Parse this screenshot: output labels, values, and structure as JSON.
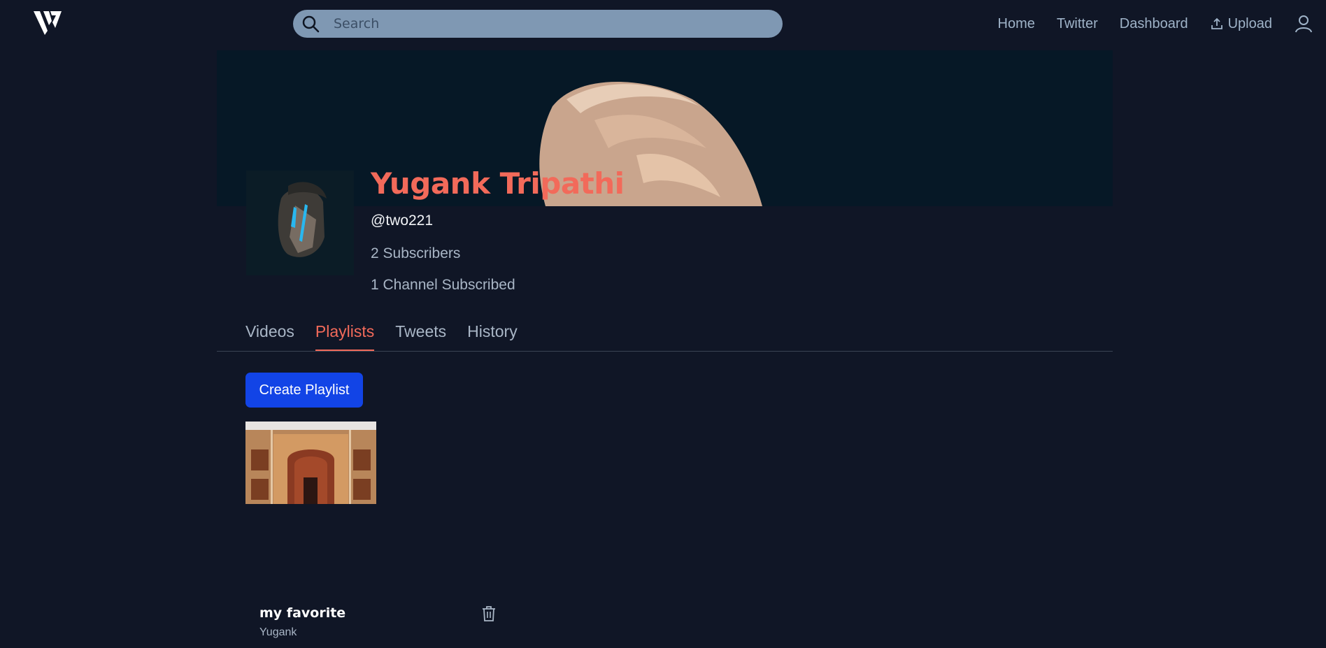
{
  "header": {
    "search_placeholder": "Search",
    "nav": {
      "home": "Home",
      "twitter": "Twitter",
      "dashboard": "Dashboard",
      "upload": "Upload"
    }
  },
  "channel": {
    "name": "Yugank Tripathi",
    "handle": "@two221",
    "subscribers": "2 Subscribers",
    "subscribed": "1 Channel Subscribed"
  },
  "tabs": [
    {
      "label": "Videos",
      "active": false
    },
    {
      "label": "Playlists",
      "active": true
    },
    {
      "label": "Tweets",
      "active": false
    },
    {
      "label": "History",
      "active": false
    }
  ],
  "actions": {
    "create_playlist": "Create Playlist"
  },
  "playlists": [
    {
      "title": "my favorite",
      "owner": "Yugank"
    }
  ],
  "colors": {
    "background": "#101626",
    "accent": "#f26a5a",
    "primary_button": "#1244e6",
    "search_bg": "#7f98b3"
  }
}
